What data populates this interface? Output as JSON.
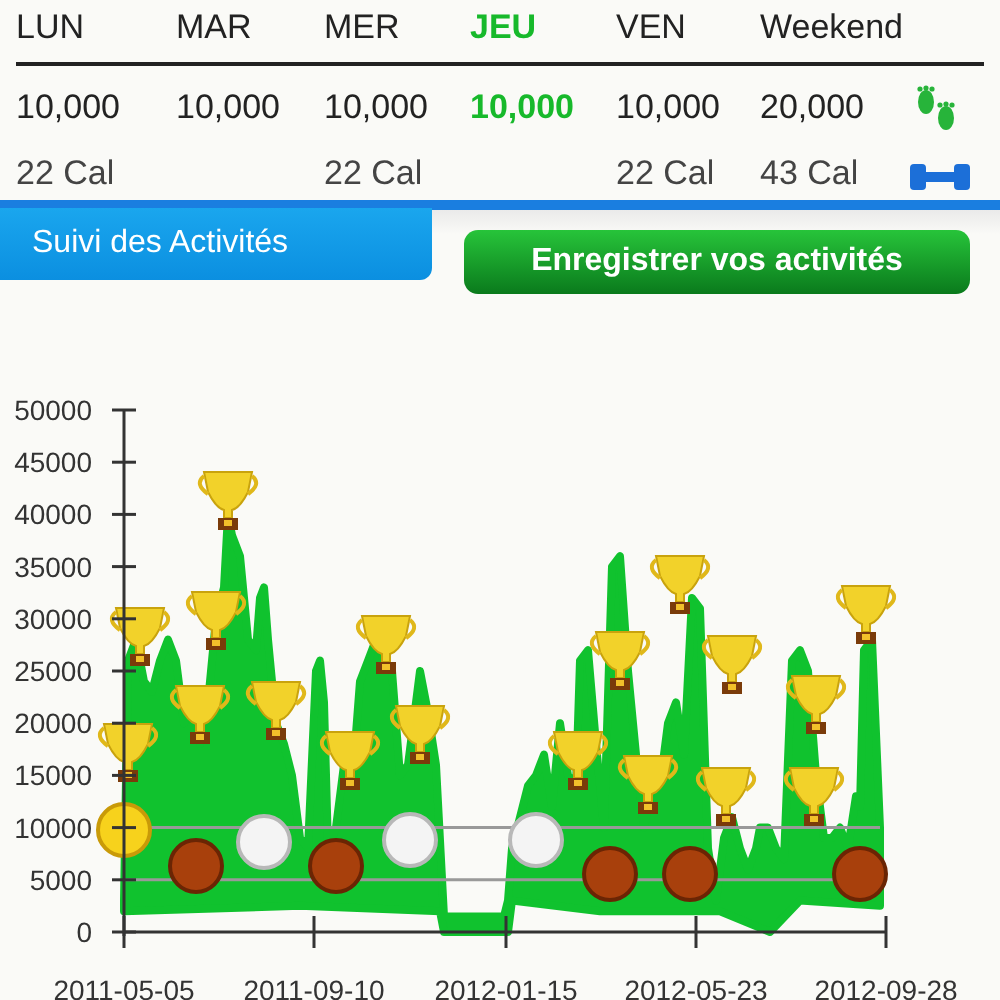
{
  "days": [
    {
      "label": "LUN",
      "steps": "10,000",
      "calories": "22 Cal",
      "selected": false
    },
    {
      "label": "MAR",
      "steps": "10,000",
      "selected": false
    },
    {
      "label": "MER",
      "steps": "10,000",
      "calories": "22 Cal",
      "selected": false
    },
    {
      "label": "JEU",
      "steps": "10,000",
      "selected": true
    },
    {
      "label": "VEN",
      "steps": "10,000",
      "calories": "22 Cal",
      "selected": false
    },
    {
      "label": "Weekend",
      "steps": "20,000",
      "calories": "43 Cal",
      "selected": false
    }
  ],
  "tab": {
    "label": "Suivi des Activités"
  },
  "record_button": {
    "label": "Enregistrer vos activités"
  },
  "chart": {
    "y_ticks": [
      "50000",
      "45000",
      "40000",
      "35000",
      "30000",
      "25000",
      "20000",
      "15000",
      "10000",
      "5000",
      "0"
    ],
    "x_labels": [
      "2011-05-05",
      "2011-09-10",
      "2012-01-15",
      "2012-05-23",
      "2012-09-28"
    ],
    "medals": [
      {
        "kind": "gold"
      },
      {
        "kind": "bronze"
      },
      {
        "kind": "silver"
      },
      {
        "kind": "bronze"
      },
      {
        "kind": "silver"
      },
      {
        "kind": "silver"
      },
      {
        "kind": "bronze"
      },
      {
        "kind": "bronze"
      },
      {
        "kind": "bronze"
      }
    ]
  }
}
